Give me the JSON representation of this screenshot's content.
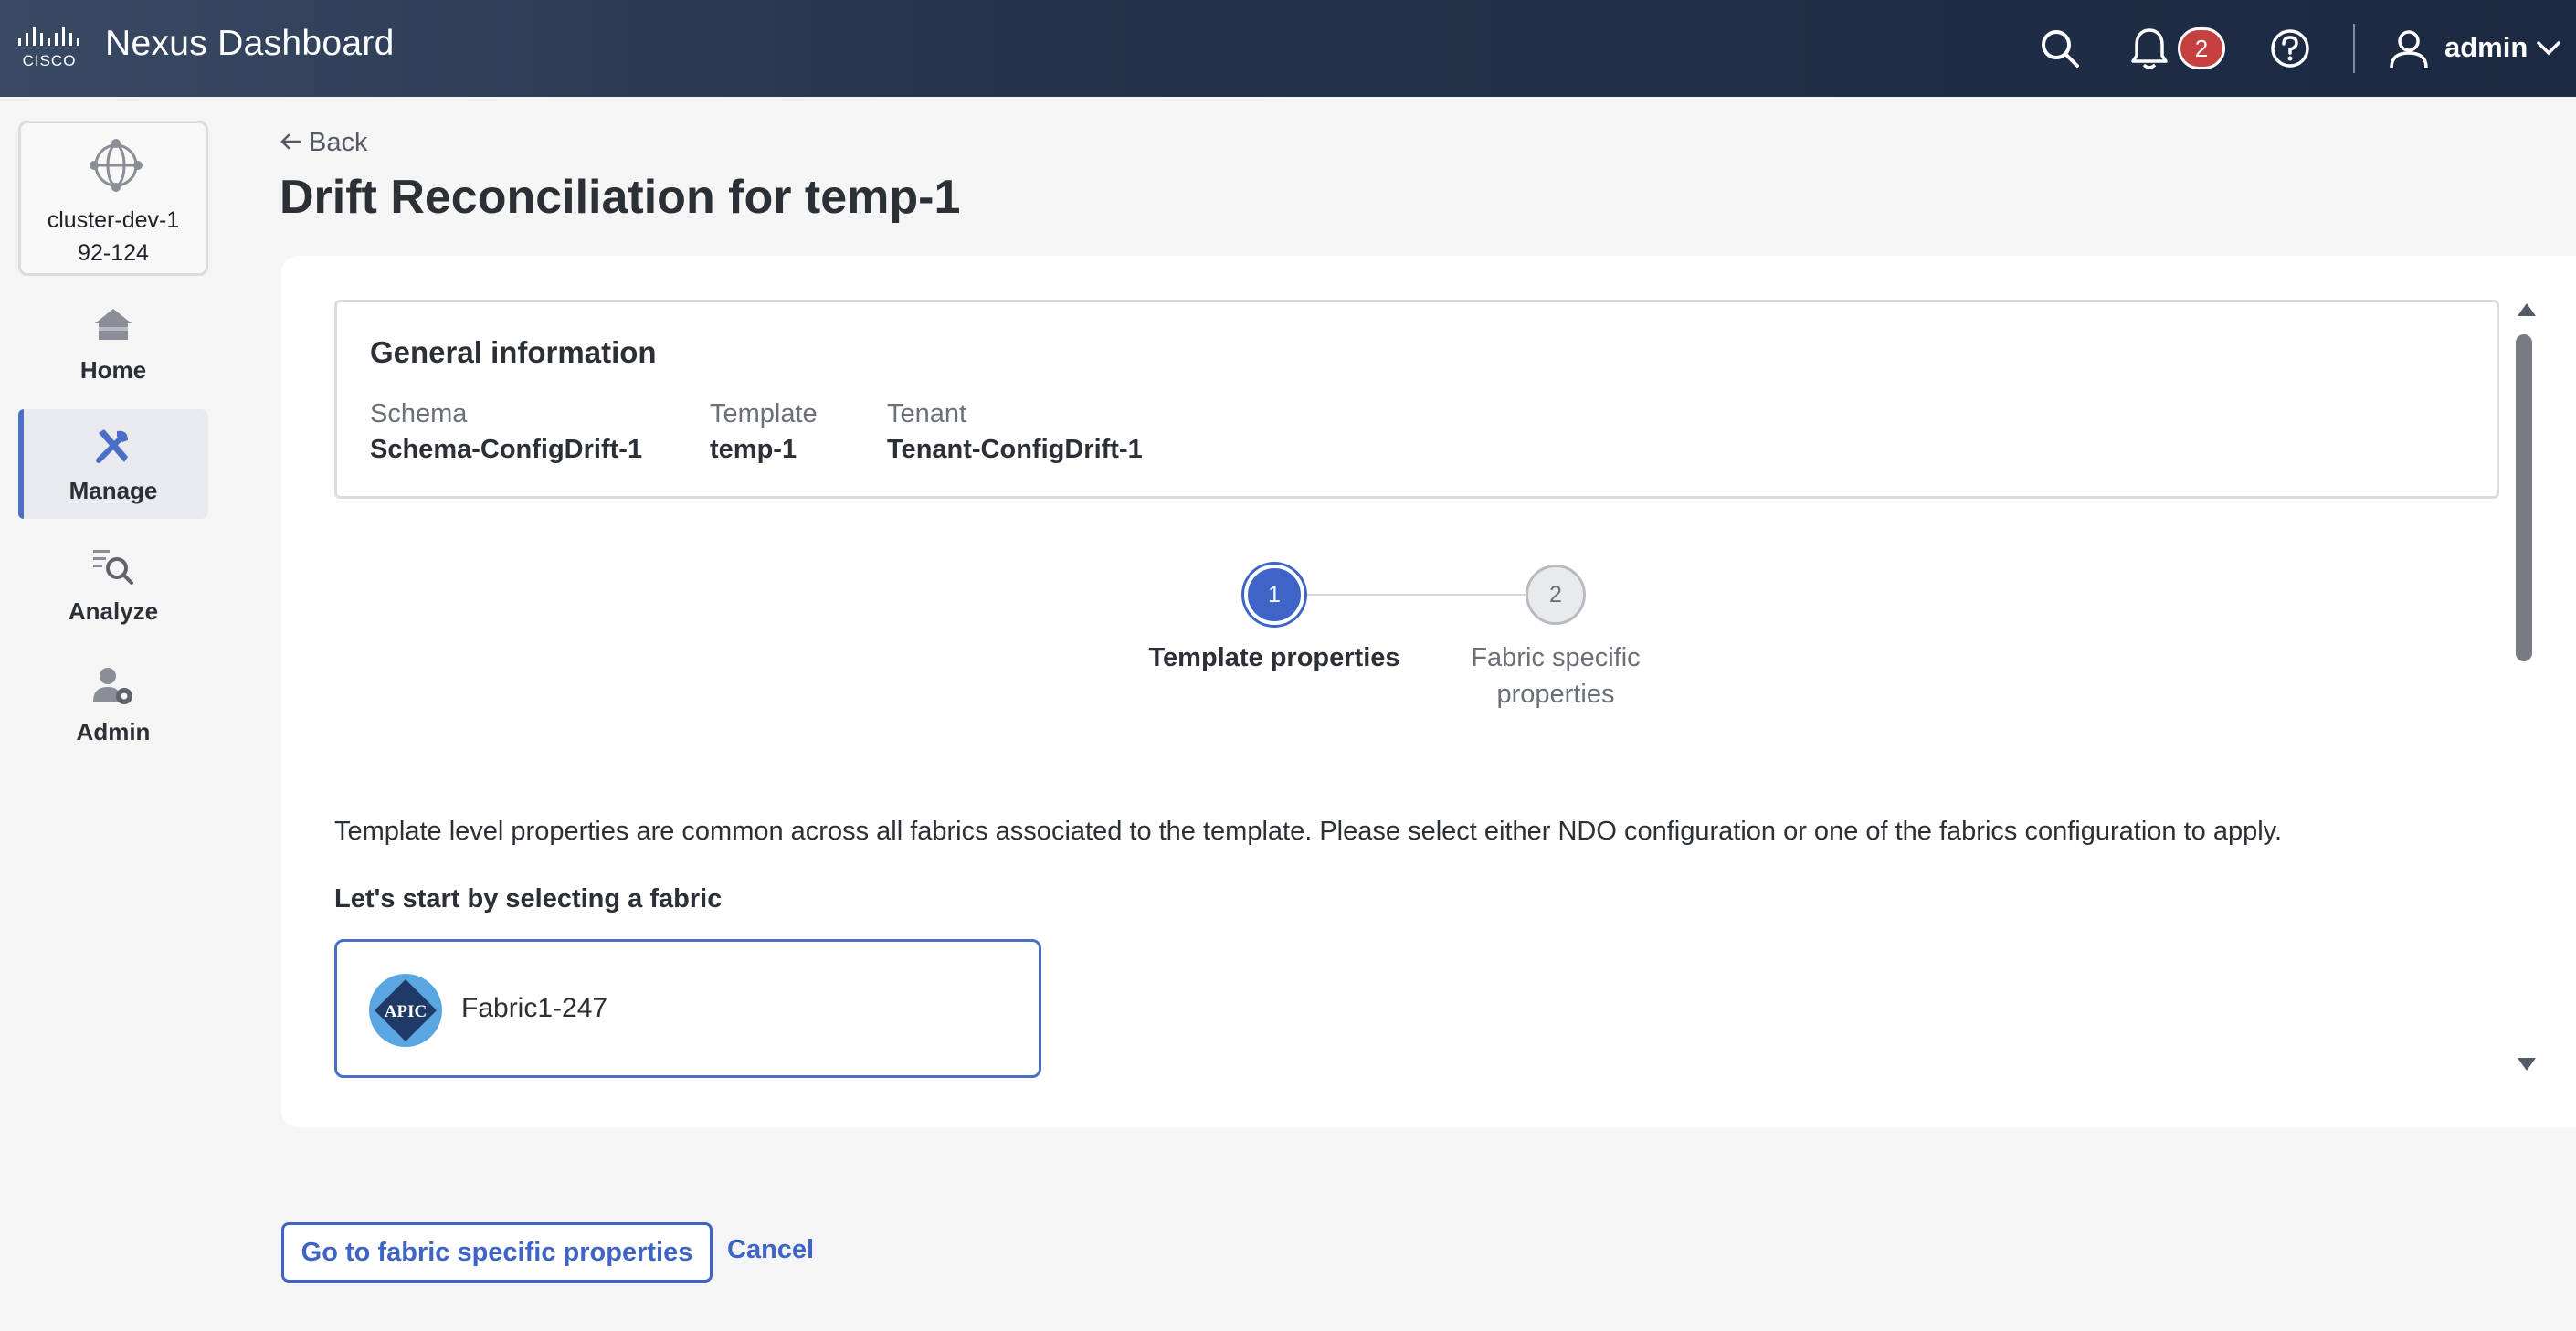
{
  "header": {
    "app_title": "Nexus Dashboard",
    "logo_text": "CISCO",
    "notification_count": "2",
    "user_name": "admin",
    "icons": [
      "search-icon",
      "bell-icon",
      "help-icon",
      "user-icon",
      "chevron-down-icon"
    ]
  },
  "sidebar": {
    "cluster_name": "cluster-dev-1\n92-124",
    "items": [
      {
        "label": "Home",
        "icon": "home-icon"
      },
      {
        "label": "Manage",
        "icon": "tools-icon",
        "active": true
      },
      {
        "label": "Analyze",
        "icon": "analyze-icon"
      },
      {
        "label": "Admin",
        "icon": "admin-icon"
      }
    ]
  },
  "main": {
    "back_label": "Back",
    "page_title": "Drift Reconciliation for temp-1",
    "general_info": {
      "title": "General information",
      "fields": [
        {
          "label": "Schema",
          "value": "Schema-ConfigDrift-1"
        },
        {
          "label": "Template",
          "value": "temp-1"
        },
        {
          "label": "Tenant",
          "value": "Tenant-ConfigDrift-1"
        }
      ]
    },
    "steps": [
      {
        "number": "1",
        "label": "Template properties",
        "active": true
      },
      {
        "number": "2",
        "label": "Fabric specific\nproperties",
        "active": false
      }
    ],
    "description": "Template level properties are common across all fabrics associated to the template. Please select either NDO configuration or one of the fabrics configuration to apply.",
    "select_title": "Let's start by selecting a fabric",
    "fabric": {
      "name": "Fabric1-247",
      "icon_text": "APIC"
    }
  },
  "footer": {
    "primary_button": "Go to fabric specific properties",
    "cancel_label": "Cancel"
  },
  "colors": {
    "accent": "#3d64c6",
    "topbar": "#24324b",
    "badge": "#c6403f"
  }
}
